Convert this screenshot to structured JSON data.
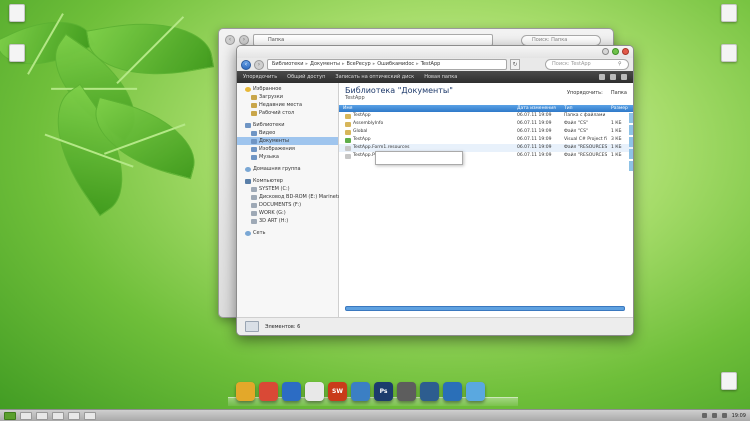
{
  "desktop": {
    "icons": [
      {
        "name": "computer",
        "label": ""
      },
      {
        "name": "recycle-bin-top",
        "label": ""
      },
      {
        "name": "desktop-right-1",
        "label": ""
      },
      {
        "name": "desktop-right-2",
        "label": ""
      },
      {
        "name": "desktop-right-3",
        "label": ""
      }
    ]
  },
  "back_window": {
    "address": "Папка",
    "search_placeholder": "Поиск: Папка"
  },
  "window": {
    "address": {
      "parts": [
        "Библиотеки",
        "Документы",
        "ВсеРесур",
        "Ошибкамиdoc",
        "TestApp"
      ]
    },
    "search_placeholder": "Поиск: TestApp",
    "toolbar": {
      "items": [
        "Упорядочить",
        "Общий доступ",
        "Записать на оптический диск",
        "Новая папка"
      ]
    },
    "nav": {
      "favorites": "Избранное",
      "fav_items": [
        "Загрузки",
        "Недавние места",
        "Рабочий стол"
      ],
      "libraries": "Библиотеки",
      "lib_items": [
        "Видео",
        "Документы",
        "Изображения",
        "Музыка"
      ],
      "homegroup": "Домашняя группа",
      "computer": "Компьютер",
      "drives": [
        "SYSTEM (C:)",
        "Дисковод BD-ROM (E:) Marinetun",
        "DOCUMENTS (F:)",
        "WORK (G:)",
        "3D ART (H:)"
      ],
      "network": "Сеть"
    },
    "library": {
      "title": "Библиотека \"Документы\"",
      "subtitle": "TestApp",
      "arrange_label": "Упорядочить:",
      "arrange_value": "Папка"
    },
    "columns": [
      "Имя",
      "Дата изменения",
      "Тип",
      "Размер"
    ],
    "rows": [
      {
        "name": "TestApp",
        "date": "06.07.11 19:09",
        "type": "Папка с файлами",
        "size": "",
        "icon": "folder"
      },
      {
        "name": "AssemblyInfo",
        "date": "06.07.11 19:09",
        "type": "Файл \"CS\"",
        "size": "1 КБ",
        "icon": "file"
      },
      {
        "name": "Global",
        "date": "06.07.11 19:09",
        "type": "Файл \"CS\"",
        "size": "1 КБ",
        "icon": "file"
      },
      {
        "name": "TestApp",
        "date": "06.07.11 19:09",
        "type": "Visual C# Project file",
        "size": "3 КБ",
        "icon": "cs"
      },
      {
        "name": "TestApp.Form1.resources",
        "date": "06.07.11 19:09",
        "type": "Файл \"RESOURCES\"",
        "size": "1 КБ",
        "icon": "res"
      },
      {
        "name": "TestApp.Properties.Resources.resources",
        "date": "06.07.11 19:09",
        "type": "Файл \"RESOURCES\"",
        "size": "1 КБ",
        "icon": "res"
      }
    ],
    "status": "Элементов: 6"
  },
  "dock": {
    "icons": [
      {
        "name": "windows-explorer-icon",
        "color": "#e3a82a",
        "label": ""
      },
      {
        "name": "chrome-icon",
        "color": "#d94936",
        "label": ""
      },
      {
        "name": "game-icon",
        "color": "#2c6cc4",
        "label": ""
      },
      {
        "name": "record-icon",
        "color": "#e8e8e8",
        "label": ""
      },
      {
        "name": "swish-icon",
        "color": "#c93a1a",
        "label": "SW"
      },
      {
        "name": "paint-icon",
        "color": "#3b7fc4",
        "label": ""
      },
      {
        "name": "photoshop-icon",
        "color": "#1c3c6d",
        "label": "Ps"
      },
      {
        "name": "sketch-icon",
        "color": "#5d5d5d",
        "label": ""
      },
      {
        "name": "cinema4d-icon",
        "color": "#2d5d8f",
        "label": ""
      },
      {
        "name": "globe-icon",
        "color": "#2a6fb8",
        "label": ""
      },
      {
        "name": "network-icon",
        "color": "#5aa8e0",
        "label": ""
      }
    ]
  },
  "taskbar": {
    "clock": "19:09"
  }
}
